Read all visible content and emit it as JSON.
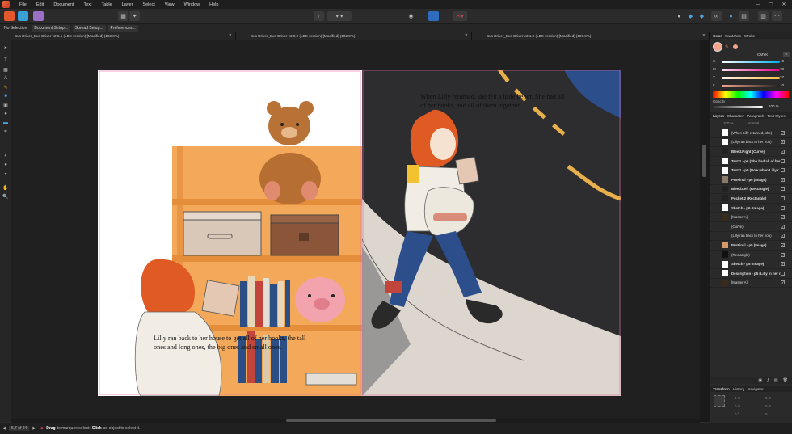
{
  "app": {
    "menu": [
      "File",
      "Edit",
      "Document",
      "Text",
      "Table",
      "Layer",
      "Select",
      "View",
      "Window",
      "Help"
    ]
  },
  "context_bar": {
    "items": [
      "No Selection",
      "Document Setup...",
      "Spread Setup...",
      "Preferences..."
    ]
  },
  "tabs": [
    {
      "label": "Bus Driver_Bus Driver v2.5.1 (LBS version) [Modified] (102.0%)"
    },
    {
      "label": "Bus Driver_Bus Driver v3.0.0 (LBS version) [Modified] (102.0%)"
    },
    {
      "label": "Bus Driver_Bus Driver v3.1.0 (LBS version) [Modified] (106.9%)"
    }
  ],
  "canvas": {
    "left_page_text": "Lilly ran back to her house to get all of her books, the tall ones and long ones, the big ones and small ones.",
    "right_page_text": "When Lilly returned, she felt a little better. She had all of her books, and all of them together."
  },
  "status": {
    "page": "6,7 of 24",
    "hint_drag": "Drag",
    "hint_drag_rest": "to marquee select.",
    "hint_click": "Click",
    "hint_click_rest": "an object to select it."
  },
  "color_panel": {
    "tabs": [
      "Color",
      "Swatches",
      "Stroke"
    ],
    "mode": "CMYK",
    "sliders": [
      {
        "label": "C",
        "value": "0",
        "color": "#00aeef"
      },
      {
        "label": "M",
        "value": "38",
        "color": "#ec008c"
      },
      {
        "label": "Y",
        "value": "37",
        "color": "#fff200"
      },
      {
        "label": "K",
        "value": "0",
        "color": "#444"
      }
    ],
    "opacity_label": "Opacity",
    "opacity_value": "100 %"
  },
  "layers_panel": {
    "tabs": [
      "Layers",
      "Character",
      "Paragraph",
      "Text Styles"
    ],
    "opacity": "100 %",
    "blend": "Normal",
    "layers": [
      {
        "name": "(When Lilly returned, she)",
        "checked": true
      },
      {
        "name": "(Lilly ran back to her hou)",
        "checked": true
      },
      {
        "name": "Bleed.Right (Curve)",
        "checked": true
      },
      {
        "name": "Text.1 - p6 (She had all of her...",
        "checked": false
      },
      {
        "name": "Text.1 - p5 (Now when Lilly r...",
        "checked": false
      },
      {
        "name": "ProFinal - p6 (Image)",
        "checked": true
      },
      {
        "name": "Bleed.Left (Rectangle)",
        "checked": false
      },
      {
        "name": "Pocket.2 (Rectangle)",
        "checked": false
      },
      {
        "name": "Sketch - p6 (Image)",
        "checked": false
      },
      {
        "name": "[Master A]",
        "checked": true
      },
      {
        "name": "(Curve)",
        "checked": true
      },
      {
        "name": "(Lilly ran back to her hou)",
        "checked": true
      },
      {
        "name": "ProFinal - p5 (Image)",
        "checked": true
      },
      {
        "name": "(Rectangle)",
        "checked": true
      },
      {
        "name": "Sketch - p5 (Image)",
        "checked": true
      },
      {
        "name": "Description - p5 (Lilly in her r...",
        "checked": false
      },
      {
        "name": "[Master A]",
        "checked": true
      }
    ]
  },
  "transform_panel": {
    "tabs": [
      "Transform",
      "History",
      "Navigator"
    ],
    "x": "0 in",
    "y": "0 in",
    "w": "0 in",
    "h": "0 in",
    "r": "0 °",
    "s": "0 °"
  },
  "colors": {
    "accent": "#f26b3a",
    "current_fill": "#f7a48d"
  }
}
